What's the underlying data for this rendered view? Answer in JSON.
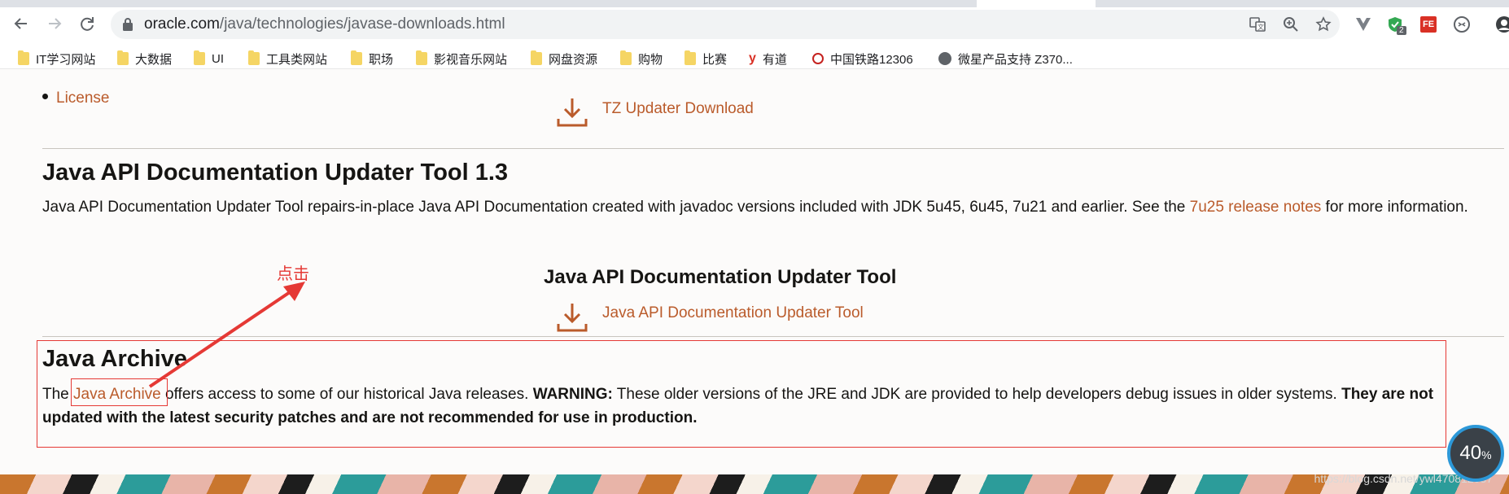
{
  "browser": {
    "url_domain": "oracle.com",
    "url_path": "/java/technologies/javase-downloads.html",
    "ext_badge": "2",
    "ext_fe_label": "FE"
  },
  "bookmarks": [
    {
      "label": "IT学习网站",
      "icon": "folder-icon"
    },
    {
      "label": "大数据",
      "icon": "folder-icon"
    },
    {
      "label": "UI",
      "icon": "folder-icon"
    },
    {
      "label": "工具类网站",
      "icon": "folder-icon"
    },
    {
      "label": "职场",
      "icon": "folder-icon"
    },
    {
      "label": "影视音乐网站",
      "icon": "folder-icon"
    },
    {
      "label": "网盘资源",
      "icon": "folder-icon"
    },
    {
      "label": "购物",
      "icon": "folder-icon"
    },
    {
      "label": "比赛",
      "icon": "folder-icon"
    },
    {
      "label": "有道",
      "icon": "youdao-icon"
    },
    {
      "label": "中国铁路12306",
      "icon": "railway-icon"
    },
    {
      "label": "微星产品支持 Z370...",
      "icon": "globe-icon"
    }
  ],
  "content": {
    "license_link": "License",
    "tz_download": "TZ Updater Download",
    "api_heading": "Java API Documentation Updater Tool 1.3",
    "api_para_before": "Java API Documentation Updater Tool repairs-in-place Java API Documentation created with javadoc versions included with JDK 5u45, 6u45, 7u21 and earlier.  See the ",
    "api_para_link": "7u25 release notes",
    "api_para_after": " for more information.",
    "api_tool_title": "Java API Documentation Updater Tool",
    "api_tool_link": "Java API Documentation Updater Tool",
    "archive_heading": "Java Archive",
    "archive_the": "The ",
    "archive_link": "Java Archive",
    "archive_mid": " offers access to some of our historical Java releases. ",
    "archive_warning": "WARNING:",
    "archive_warning_text": " These older versions of the JRE and JDK are provided to help developers debug issues in older systems. ",
    "archive_bold1": "They are not",
    "archive_bold2": "updated with the latest security patches and are not recommended for use in production."
  },
  "annotation": {
    "label": "点击",
    "color": "#e53935"
  },
  "overlay": {
    "gauge_value": "40",
    "gauge_unit": "%",
    "watermark": "https://blog.csdn.net/ywl470812087"
  },
  "colors": {
    "link": "#ba5b2b",
    "annotation": "#e53935",
    "text": "#161513"
  }
}
